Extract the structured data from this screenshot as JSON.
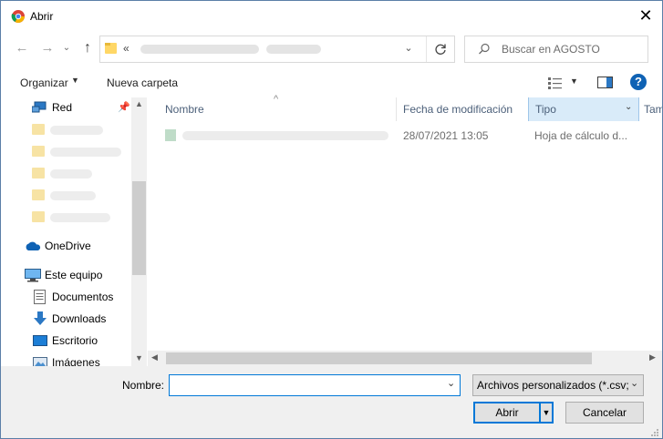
{
  "window": {
    "title": "Abrir"
  },
  "address": {
    "prefix": "«"
  },
  "search": {
    "placeholder": "Buscar en AGOSTO"
  },
  "toolbar": {
    "organize_label": "Organizar",
    "new_folder_label": "Nueva carpeta"
  },
  "sidebar": {
    "items": [
      {
        "label": "Red"
      },
      {
        "label": "OneDrive"
      },
      {
        "label": "Este equipo"
      },
      {
        "label": "Documentos"
      },
      {
        "label": "Downloads"
      },
      {
        "label": "Escritorio"
      },
      {
        "label": "Imágenes"
      }
    ]
  },
  "columns": {
    "name": "Nombre",
    "modified": "Fecha de modificación",
    "type": "Tipo",
    "size": "Tam"
  },
  "files": [
    {
      "modified": "28/07/2021 13:05",
      "type": "Hoja de cálculo d..."
    }
  ],
  "bottom": {
    "filename_label": "Nombre:",
    "filename_value": "",
    "filter_value": "Archivos personalizados (*.csv;*",
    "open_label": "Abrir",
    "cancel_label": "Cancelar"
  },
  "colors": {
    "accent": "#0078d7",
    "selected_header": "#cce8ff",
    "folder": "#ffd766"
  }
}
